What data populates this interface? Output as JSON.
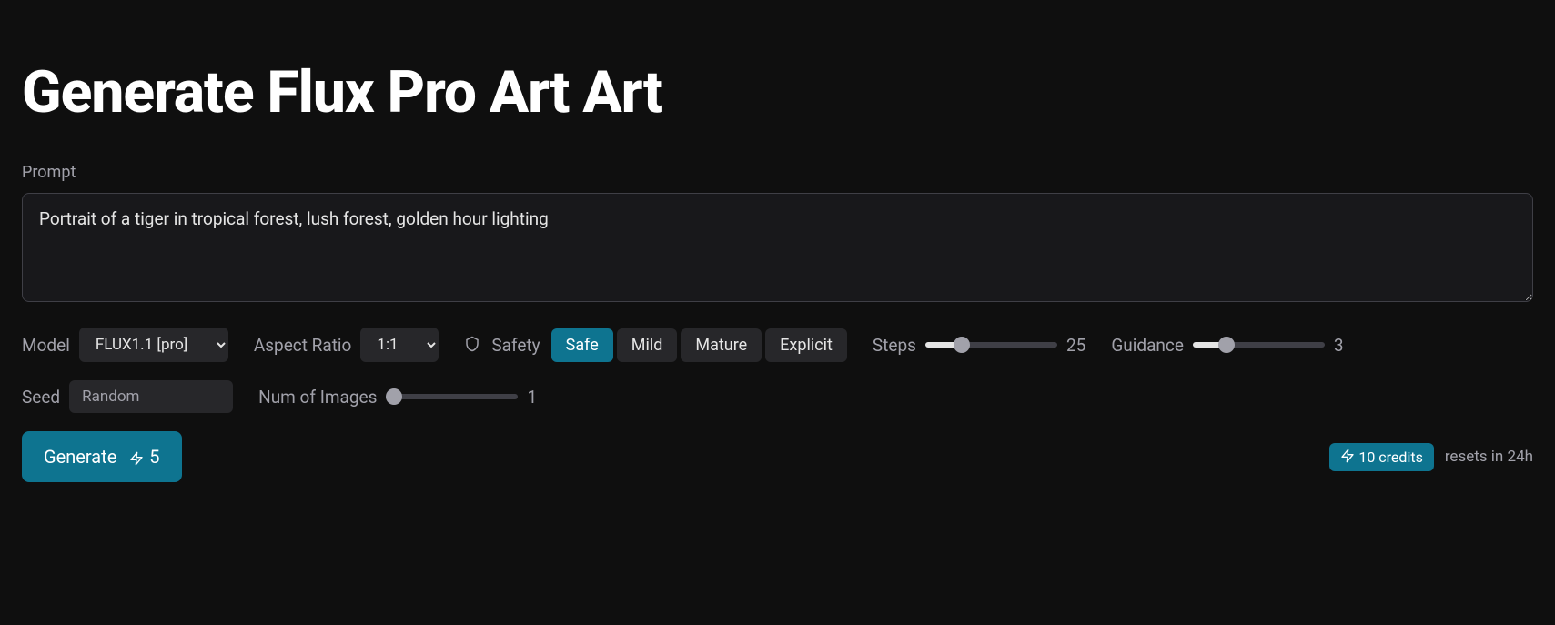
{
  "title": "Generate Flux Pro Art Art",
  "prompt": {
    "label": "Prompt",
    "value": "Portrait of a tiger in tropical forest, lush forest, golden hour lighting"
  },
  "model": {
    "label": "Model",
    "selected": "FLUX1.1 [pro]"
  },
  "aspect_ratio": {
    "label": "Aspect Ratio",
    "selected": "1:1"
  },
  "safety": {
    "label": "Safety",
    "options": [
      "Safe",
      "Mild",
      "Mature",
      "Explicit"
    ],
    "selected": "Safe"
  },
  "steps": {
    "label": "Steps",
    "value": 25,
    "min": 1,
    "max": 100
  },
  "guidance": {
    "label": "Guidance",
    "value": 3,
    "min": 1,
    "max": 10
  },
  "seed": {
    "label": "Seed",
    "placeholder": "Random",
    "value": ""
  },
  "num_images": {
    "label": "Num of Images",
    "value": 1,
    "min": 1,
    "max": 10
  },
  "generate": {
    "label": "Generate",
    "cost": "5"
  },
  "credits": {
    "badge": "10 credits",
    "resets": "resets in 24h"
  },
  "colors": {
    "accent": "#0e7490",
    "bg": "#0f0f0f",
    "panel": "#18181b",
    "control": "#27272a"
  }
}
